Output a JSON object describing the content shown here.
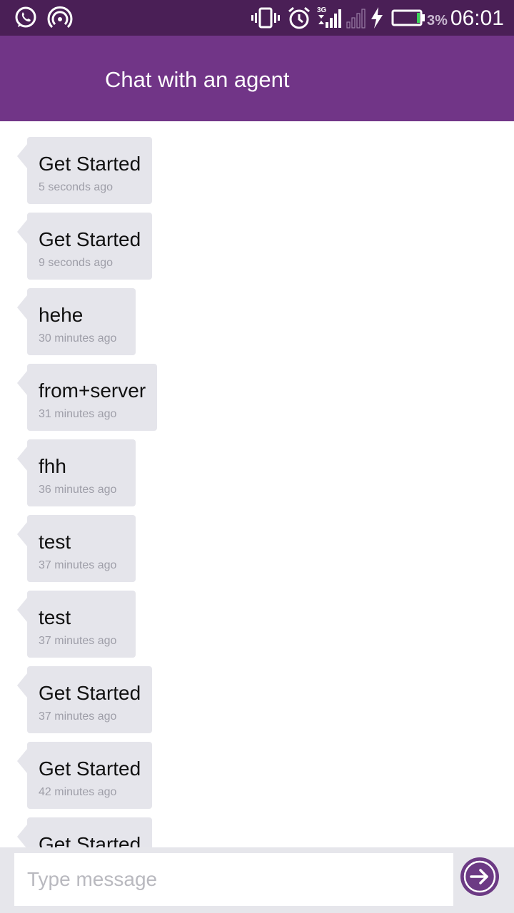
{
  "status_bar": {
    "network_label": "3G",
    "battery_percent": "3%",
    "time": "06:01",
    "icons": [
      "whatsapp-icon",
      "hotspot-icon",
      "vibrate-icon",
      "alarm-icon",
      "signal-3g-icon",
      "signal-empty-icon",
      "charging-icon",
      "battery-icon"
    ]
  },
  "header": {
    "title": "Chat with an agent"
  },
  "messages": [
    {
      "text": "Get Started",
      "time": "5 seconds ago"
    },
    {
      "text": "Get Started",
      "time": "9 seconds ago"
    },
    {
      "text": "hehe",
      "time": "30 minutes ago"
    },
    {
      "text": "from+server",
      "time": "31 minutes ago"
    },
    {
      "text": "fhh",
      "time": "36 minutes ago"
    },
    {
      "text": "test",
      "time": "37 minutes ago"
    },
    {
      "text": "test",
      "time": "37 minutes ago"
    },
    {
      "text": "Get Started",
      "time": "37 minutes ago"
    },
    {
      "text": "Get Started",
      "time": "42 minutes ago"
    },
    {
      "text": "Get Started",
      "time": ""
    }
  ],
  "composer": {
    "placeholder": "Type message",
    "value": "",
    "send_icon": "arrow-right-icon"
  },
  "colors": {
    "status_bar": "#4a1f56",
    "app_bar": "#713587",
    "bubble": "#e5e5eb",
    "send_button": "#6c3a84"
  }
}
